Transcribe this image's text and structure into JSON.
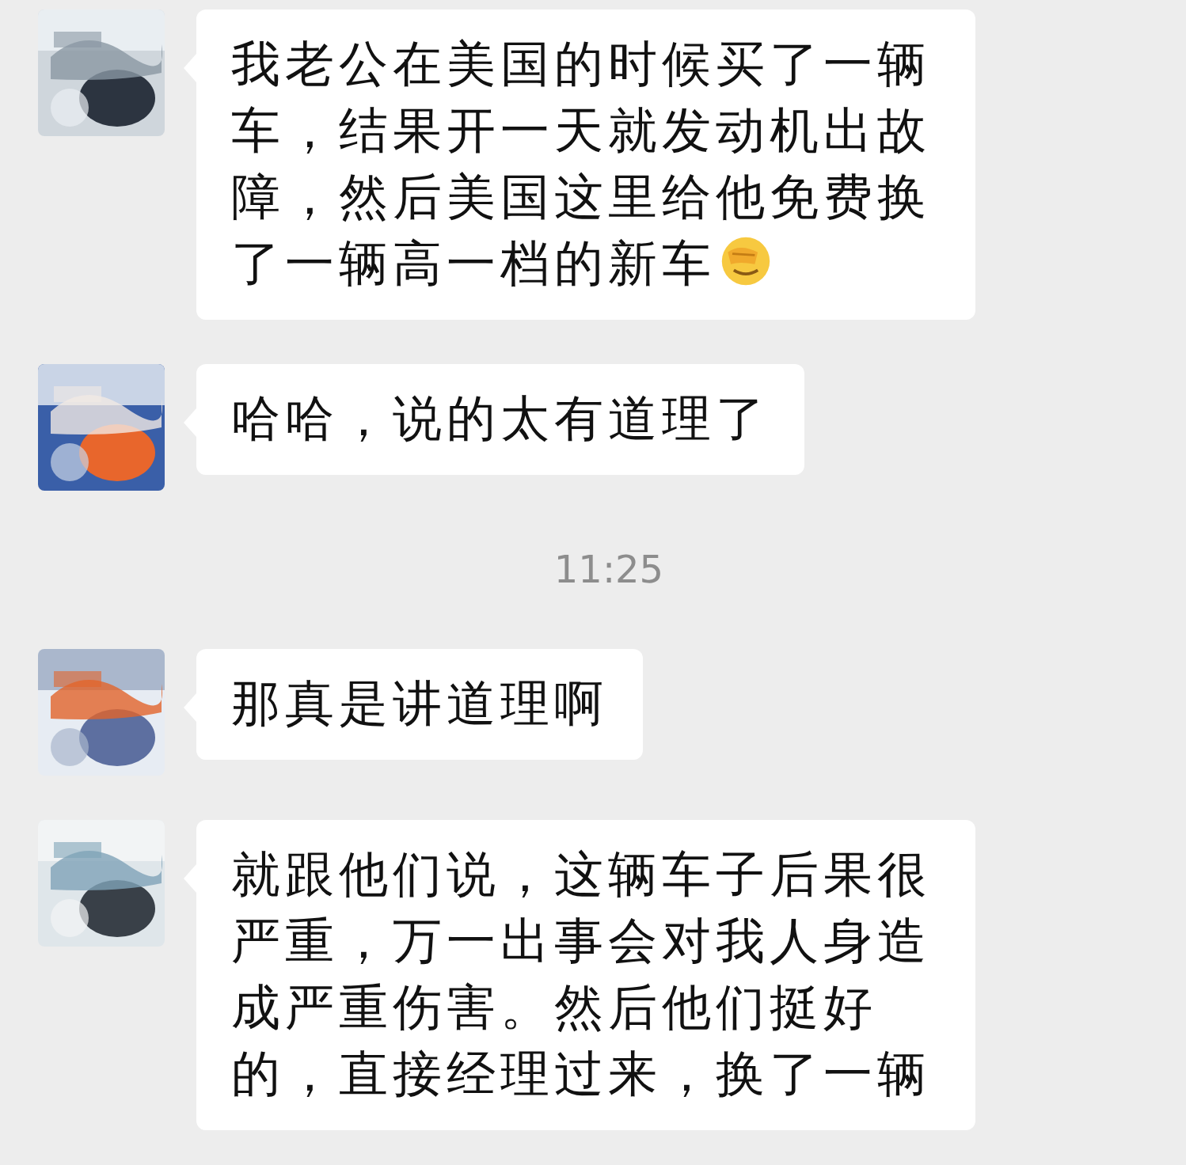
{
  "chat": [
    {
      "kind": "message",
      "text": "我老公在美国的时候买了一辆车，结果开一天就发动机出故障，然后美国这里给他免费换了一辆高一档的新车",
      "ends_with_emoji": true
    },
    {
      "kind": "message",
      "text": "哈哈，说的太有道理了"
    },
    {
      "kind": "time",
      "text": "11:25"
    },
    {
      "kind": "message",
      "text": "那真是讲道理啊"
    },
    {
      "kind": "message",
      "text": "就跟他们说，这辆车子后果很严重，万一出事会对我人身造成严重伤害。然后他们挺好的，直接经理过来，换了一辆"
    }
  ]
}
